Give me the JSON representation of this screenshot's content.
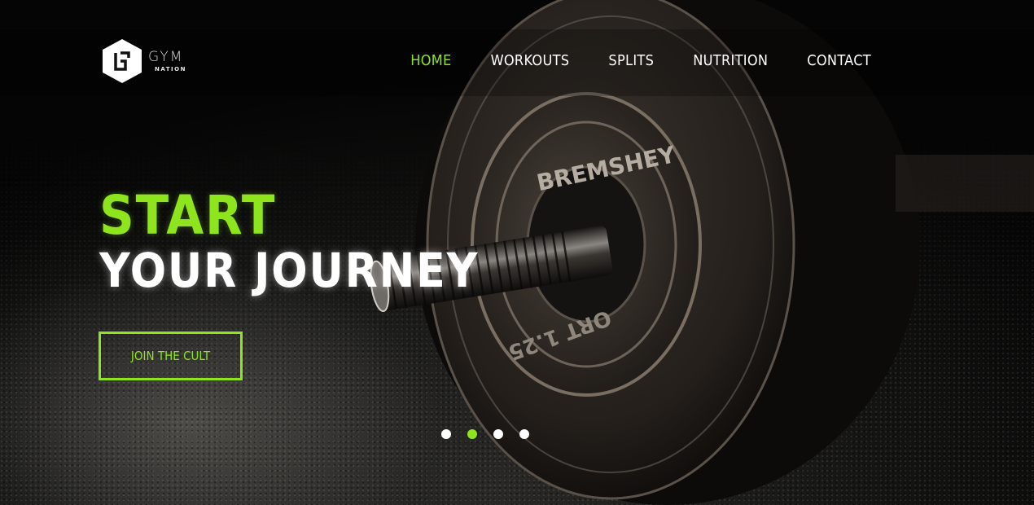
{
  "brand": {
    "name_top": "GYM",
    "name_bottom": "NATION",
    "logo_letter": "G"
  },
  "nav": {
    "items": [
      {
        "label": "HOME",
        "active": true
      },
      {
        "label": "WORKOUTS",
        "active": false
      },
      {
        "label": "SPLITS",
        "active": false
      },
      {
        "label": "NUTRITION",
        "active": false
      },
      {
        "label": "CONTACT",
        "active": false
      }
    ]
  },
  "hero": {
    "title_line1": "START",
    "title_line2": "YOUR JOURNEY",
    "cta_label": "JOIN THE CULT",
    "plate_text": "BREMSHEY",
    "plate_text_bottom": "ORT 1.25"
  },
  "slider": {
    "count": 4,
    "active_index": 1
  },
  "colors": {
    "accent": "#8ee51d",
    "nav_text": "#ffffff",
    "background": "#000000"
  },
  "icons": [
    "gym-nation-logo-icon",
    "dumbbell-plate-image"
  ]
}
